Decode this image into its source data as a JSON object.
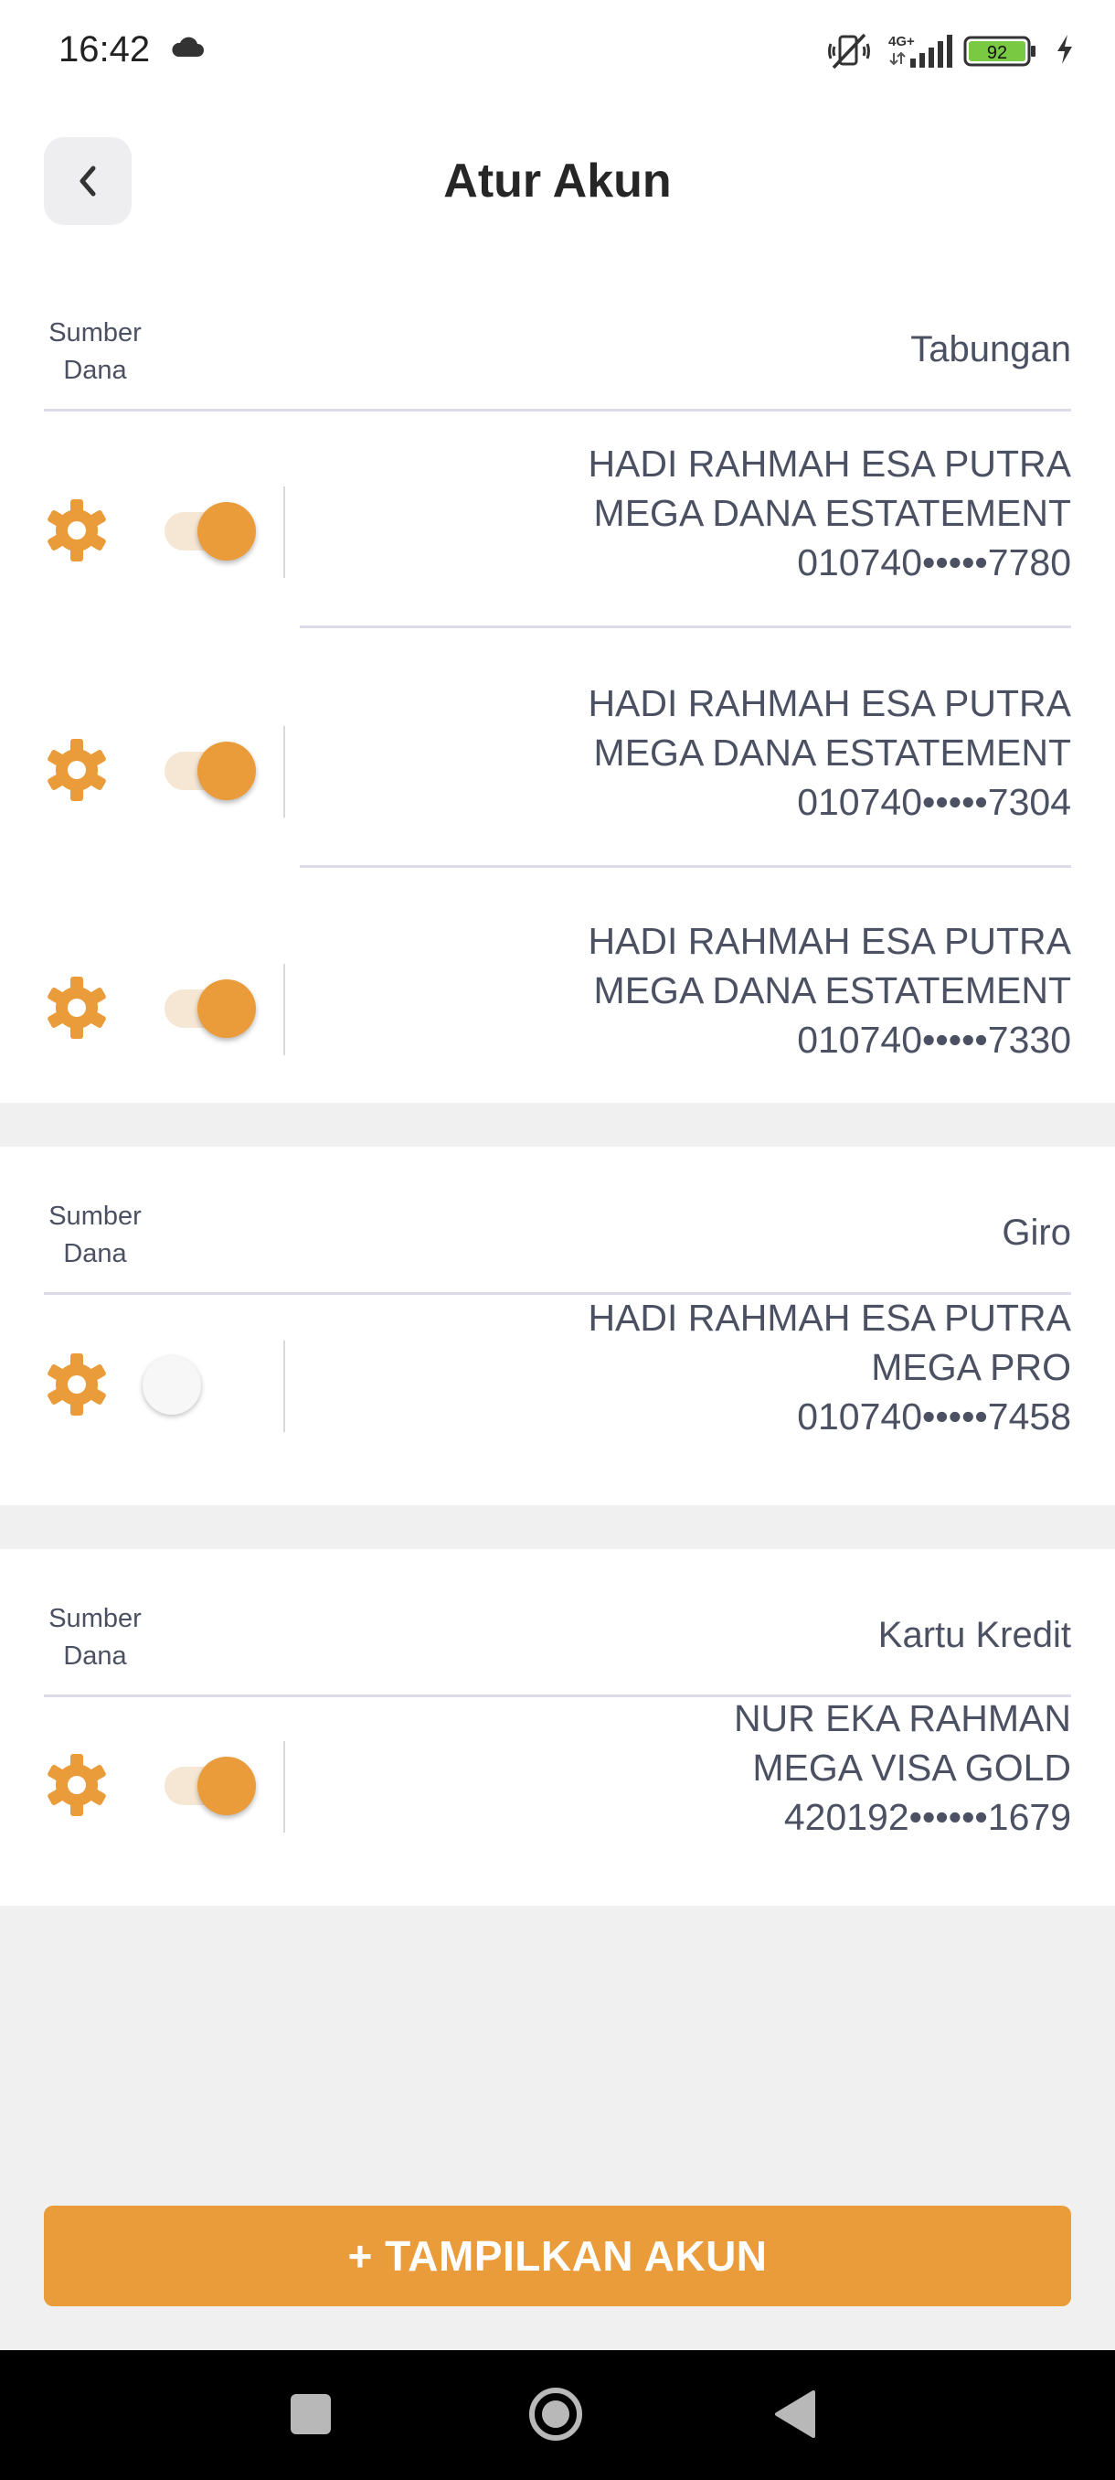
{
  "status_bar": {
    "time": "16:42",
    "network": "4G+",
    "battery": "92",
    "icons": [
      "cloud-icon",
      "mute-icon",
      "signal-icon",
      "battery-icon",
      "charging-icon"
    ]
  },
  "header": {
    "title": "Atur Akun",
    "back_icon": "chevron-left-icon"
  },
  "sections": [
    {
      "label": "Sumber Dana",
      "type": "Tabungan",
      "accounts": [
        {
          "name": "HADI RAHMAH ESA PUTRA",
          "product": "MEGA DANA ESTATEMENT",
          "number": "010740•••••7780",
          "enabled": true
        },
        {
          "name": "HADI RAHMAH ESA PUTRA",
          "product": "MEGA DANA ESTATEMENT",
          "number": "010740•••••7304",
          "enabled": true
        },
        {
          "name": "HADI RAHMAH ESA PUTRA",
          "product": "MEGA DANA ESTATEMENT",
          "number": "010740•••••7330",
          "enabled": true
        }
      ]
    },
    {
      "label": "Sumber Dana",
      "type": "Giro",
      "accounts": [
        {
          "name": "HADI RAHMAH ESA PUTRA",
          "product": "MEGA PRO",
          "number": "010740•••••7458",
          "enabled": false
        }
      ]
    },
    {
      "label": "Sumber Dana",
      "type": "Kartu Kredit",
      "accounts": [
        {
          "name": "NUR EKA RAHMAN",
          "product": "MEGA VISA GOLD",
          "number": "420192••••••1679",
          "enabled": true
        }
      ]
    }
  ],
  "actions": {
    "show_account": "+ TAMPILKAN AKUN"
  },
  "colors": {
    "accent": "#EA9C3B",
    "toggle_track_on": "#F6E7D4",
    "background": "#F0F0F0"
  }
}
